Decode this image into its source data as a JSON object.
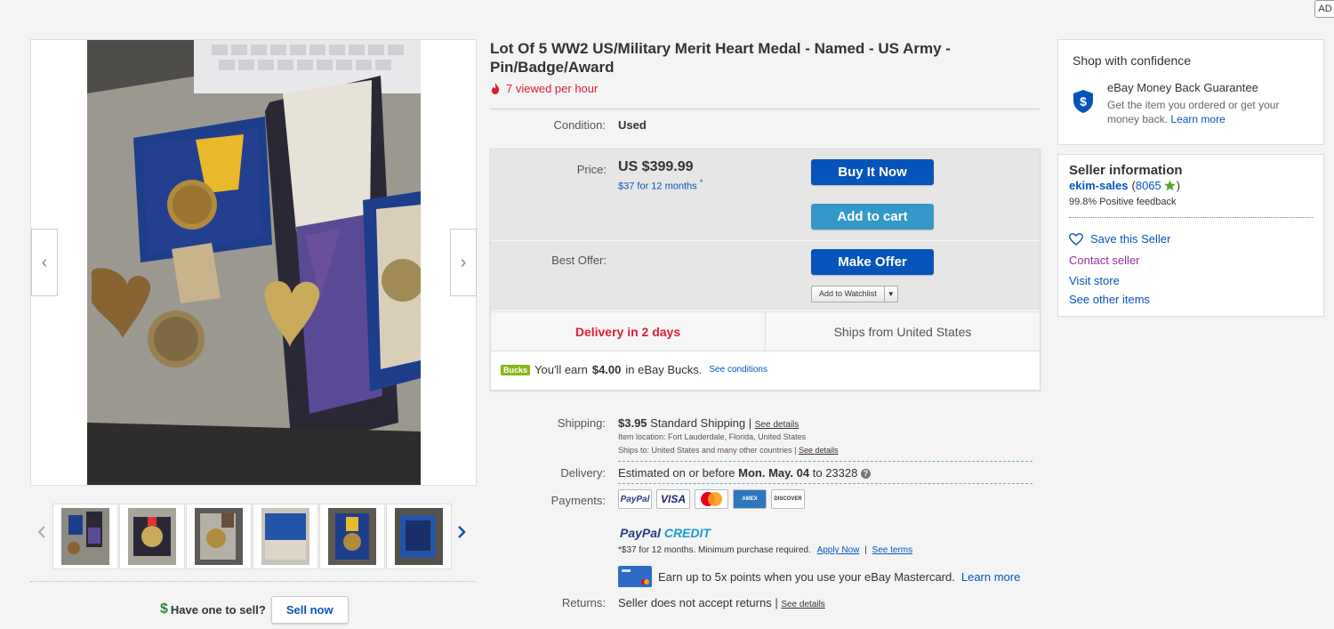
{
  "ad_badge": "AD",
  "gallery": {
    "prev_arrow": "‹",
    "next_arrow": "›",
    "thumb_count": 6
  },
  "sell": {
    "dollar": "$",
    "question": "Have one to sell?",
    "button": "Sell now"
  },
  "item": {
    "title": "Lot Of 5 WW2 US/Military Merit Heart Medal - Named - US Army - Pin/Badge/Award",
    "viewed": "7 viewed per hour",
    "condition_label": "Condition:",
    "condition_value": "Used"
  },
  "buybox": {
    "price_label": "Price:",
    "price": "US $399.99",
    "financing": "$37 for 12 months",
    "financing_mark": "*",
    "buy_now": "Buy It Now",
    "add_to_cart": "Add to cart",
    "offer_label": "Best Offer:",
    "make_offer": "Make Offer",
    "watchlist": "Add to Watchlist",
    "watchlist_arrow": "▼",
    "delivery_fast": "Delivery in 2 days",
    "ships_from": "Ships from United States",
    "bucks_logo": "Bucks",
    "bucks_text_1": "You'll earn",
    "bucks_amount": "$4.00",
    "bucks_text_2": "in eBay Bucks.",
    "bucks_link": "See conditions"
  },
  "shipping": {
    "label": "Shipping:",
    "cost": "$3.95",
    "method": "Standard Shipping |",
    "see_details": "See details",
    "location": "Item location:  Fort Lauderdale, Florida, United States",
    "ships_to": "Ships to:  United States and many other countries |",
    "ships_to_link": "See details"
  },
  "delivery": {
    "label": "Delivery:",
    "text_1": "Estimated on or before",
    "date": "Mon. May. 04",
    "text_2": "to 23328",
    "help": "?"
  },
  "payments": {
    "label": "Payments:",
    "logos": [
      "PayPal",
      "VISA",
      "MasterCard",
      "AMEX",
      "DISCOVER"
    ],
    "credit_logo_1": "PayPal",
    "credit_logo_2": "CREDIT",
    "credit_terms": "*$37 for 12 months. Minimum purchase required.",
    "apply_now": "Apply Now",
    "sep": "|",
    "see_terms": "See terms",
    "mastercard_text": "Earn up to 5x points when you use your eBay Mastercard.",
    "learn_more": "Learn more"
  },
  "returns": {
    "label": "Returns:",
    "text": "Seller does not accept returns |",
    "link": "See details"
  },
  "confidence": {
    "heading": "Shop with confidence",
    "icon_letter": "$",
    "title": "eBay Money Back Guarantee",
    "desc": "Get the item you ordered or get your money back.",
    "link": "Learn more"
  },
  "seller": {
    "heading": "Seller information",
    "name": "ekim-sales",
    "feedback_open": "(",
    "feedback_count": "8065",
    "feedback_close": ")",
    "positive": "99.8% Positive feedback",
    "save": "Save this Seller",
    "contact": "Contact seller",
    "visit": "Visit store",
    "other": "See other items"
  }
}
